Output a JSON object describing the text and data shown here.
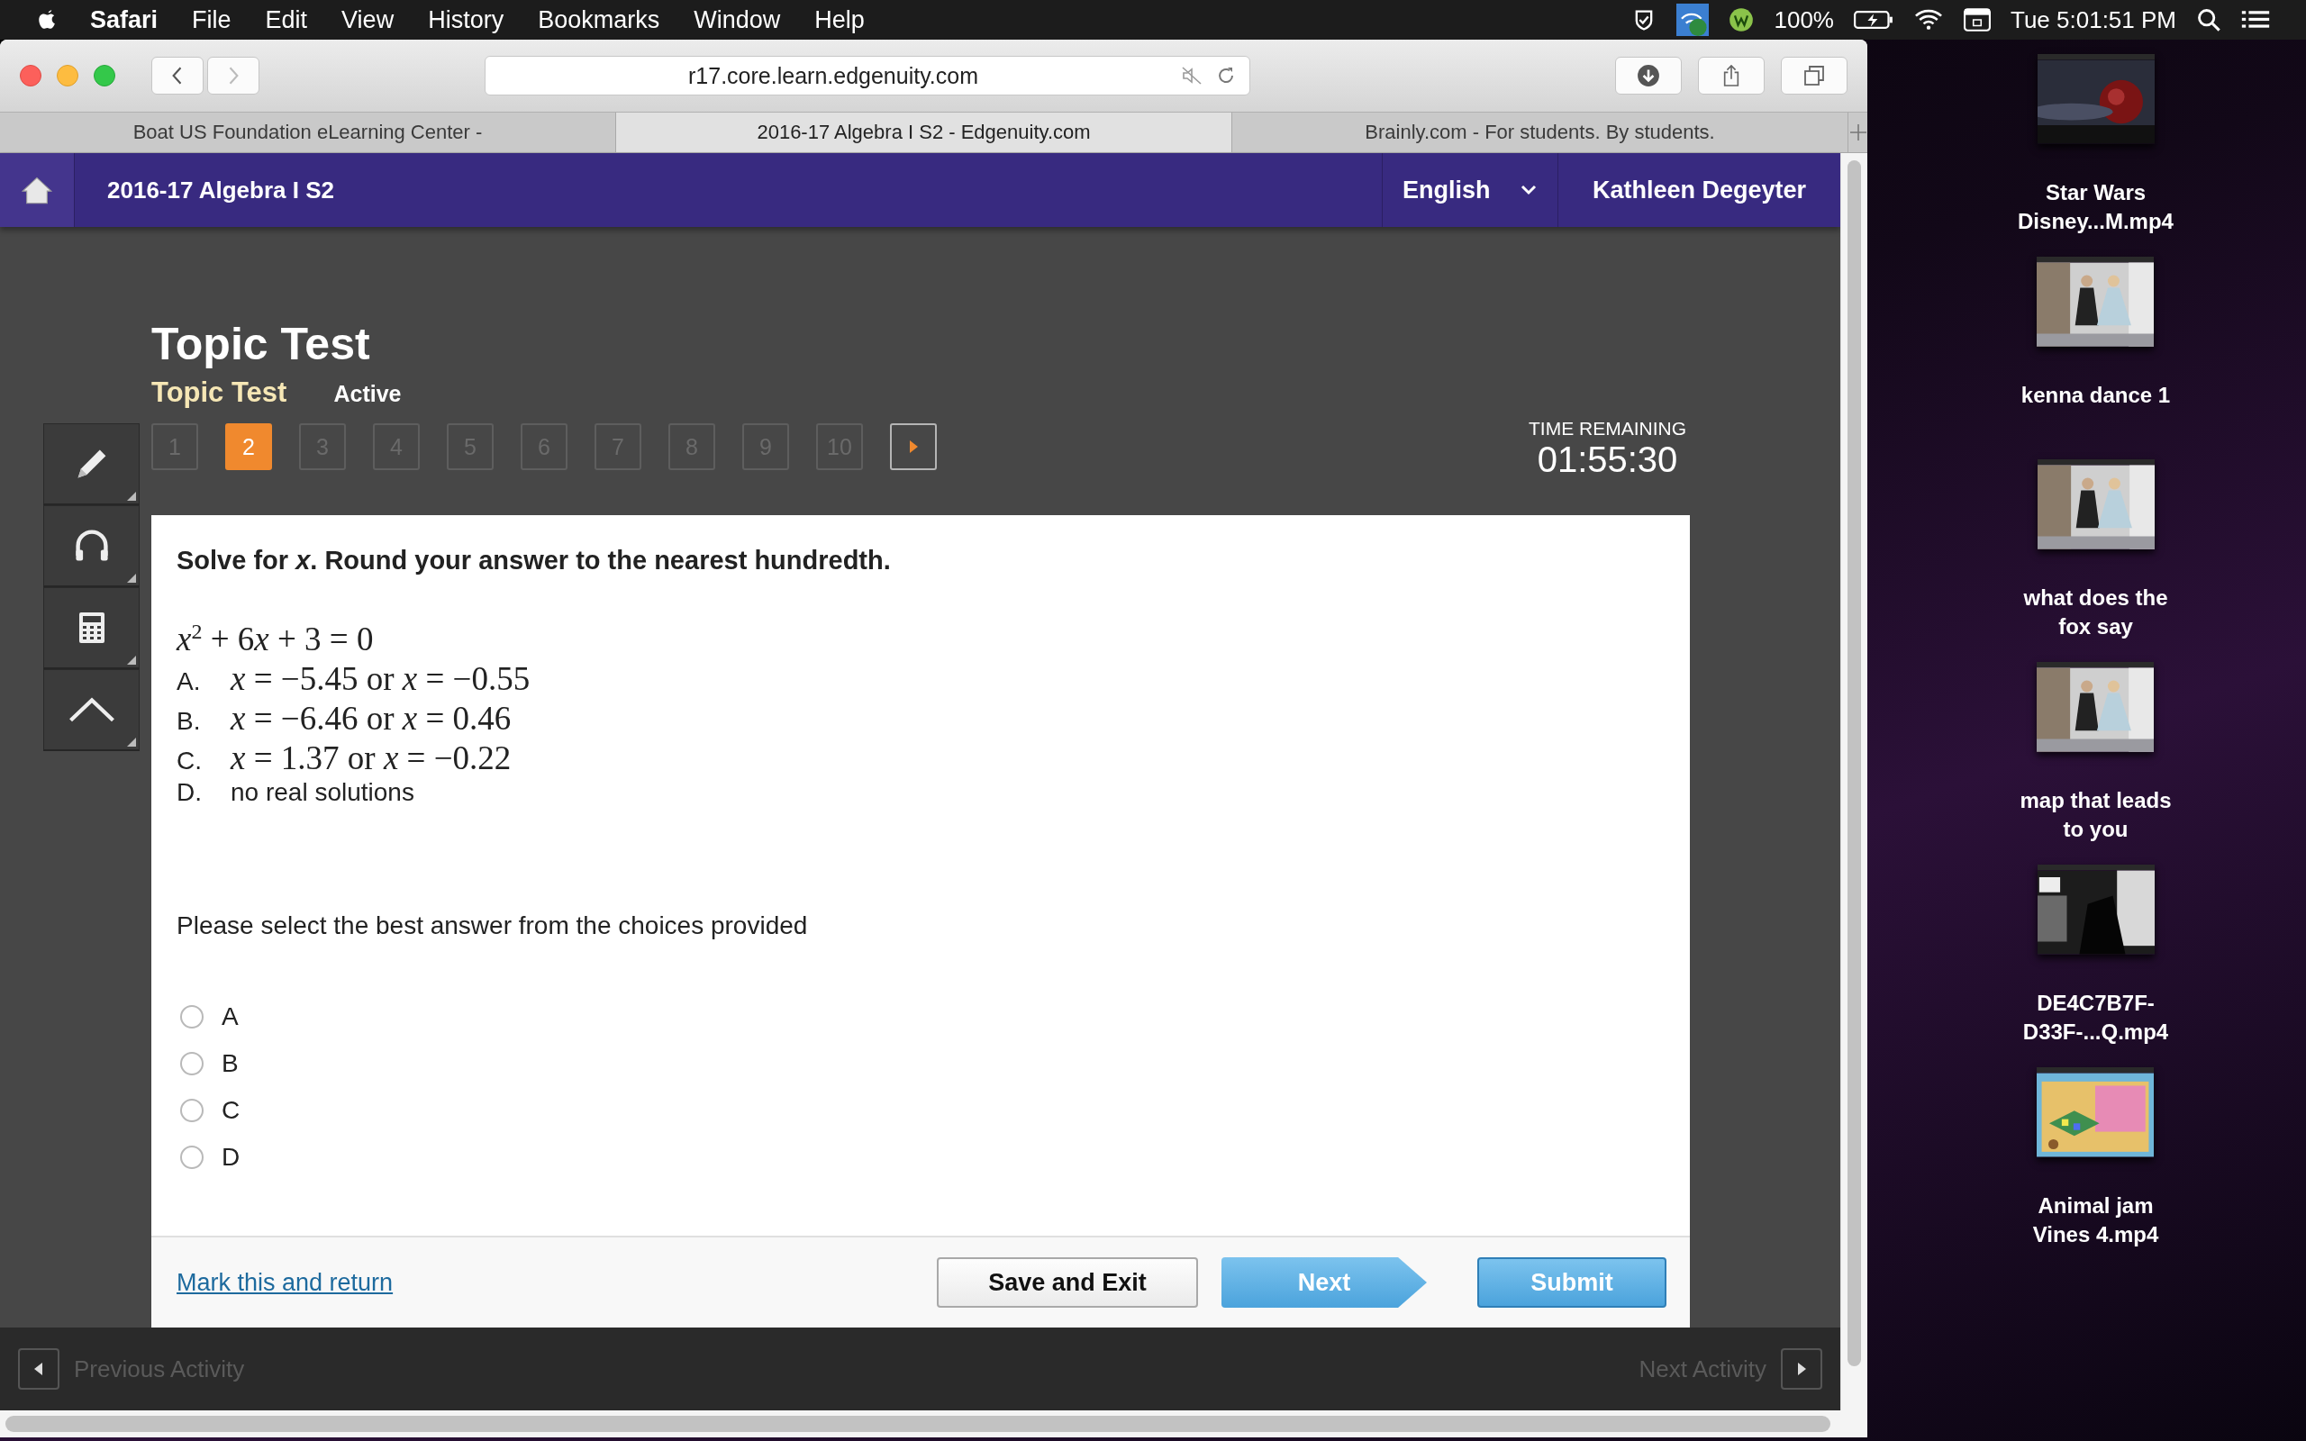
{
  "menu_bar": {
    "app": "Safari",
    "menus": [
      "File",
      "Edit",
      "View",
      "History",
      "Bookmarks",
      "Window",
      "Help"
    ],
    "battery": "100%",
    "clock": "Tue 5:01:51 PM"
  },
  "browser": {
    "url": "r17.core.learn.edgenuity.com",
    "tabs": [
      {
        "title": "Boat US Foundation eLearning Center -",
        "selected": false
      },
      {
        "title": "2016-17 Algebra I S2 - Edgenuity.com",
        "selected": true
      },
      {
        "title": "Brainly.com - For students. By students.",
        "selected": false
      }
    ]
  },
  "header": {
    "course": "2016-17 Algebra I S2",
    "language": "English",
    "user": "Kathleen Degeyter"
  },
  "activity": {
    "title": "Topic Test",
    "subtitle": "Topic Test",
    "status": "Active"
  },
  "questions": [
    {
      "label": "1",
      "selected": false
    },
    {
      "label": "2",
      "selected": true
    },
    {
      "label": "3",
      "selected": false
    },
    {
      "label": "4",
      "selected": false
    },
    {
      "label": "5",
      "selected": false
    },
    {
      "label": "6",
      "selected": false
    },
    {
      "label": "7",
      "selected": false
    },
    {
      "label": "8",
      "selected": false
    },
    {
      "label": "9",
      "selected": false
    },
    {
      "label": "10",
      "selected": false
    }
  ],
  "timer": {
    "label": "TIME REMAINING",
    "value": "01:55:30"
  },
  "tools": [
    {
      "kind": "pencil"
    },
    {
      "kind": "headphones"
    },
    {
      "kind": "calculator"
    },
    {
      "kind": "caret"
    }
  ],
  "question": {
    "prompt": "Solve for *x*. Round your answer to the nearest hundredth.",
    "equation": [
      {
        "kind": "var",
        "text": "x"
      },
      {
        "kind": "sup",
        "text": "2"
      },
      {
        "kind": "plain",
        "text": " + 6"
      },
      {
        "kind": "var",
        "text": "x"
      },
      {
        "kind": "plain",
        "text": " + 3 = 0"
      }
    ],
    "options": [
      {
        "letter": "A.",
        "kind": "math",
        "text": "*x* = −5.45 or *x* = −0.55"
      },
      {
        "letter": "B.",
        "kind": "math",
        "text": "*x* = −6.46 or *x* = 0.46"
      },
      {
        "letter": "C.",
        "kind": "math",
        "text": "*x* = 1.37 or *x* = −0.22"
      },
      {
        "letter": "D.",
        "kind": "plain",
        "text": "no real solutions"
      }
    ],
    "instruction": "Please select the best answer from the choices provided",
    "choices": [
      {
        "label": "A",
        "selected": false
      },
      {
        "label": "B",
        "selected": false
      },
      {
        "label": "C",
        "selected": false
      },
      {
        "label": "D",
        "selected": false
      }
    ]
  },
  "footer": {
    "link": "Mark this and return",
    "buttons": [
      {
        "label": "Save and Exit",
        "kind": "secondary"
      },
      {
        "label": "Next",
        "kind": "next"
      },
      {
        "label": "Submit",
        "kind": "primary"
      }
    ]
  },
  "bottom_bar": {
    "previous": "Previous Activity",
    "next": "Next Activity"
  },
  "desktop": [
    {
      "kind": "space",
      "lines": [
        "Star Wars",
        "Disney...M.mp4"
      ]
    },
    {
      "kind": "room",
      "lines": [
        "kenna dance 1"
      ]
    },
    {
      "kind": "room",
      "lines": [
        "what does the",
        "fox say"
      ]
    },
    {
      "kind": "room",
      "lines": [
        "map that leads",
        "to you"
      ]
    },
    {
      "kind": "dark",
      "lines": [
        "DE4C7B7F-",
        "D33F-...Q.mp4"
      ]
    },
    {
      "kind": "game",
      "lines": [
        "Animal jam",
        "Vines 4.mp4"
      ]
    }
  ]
}
